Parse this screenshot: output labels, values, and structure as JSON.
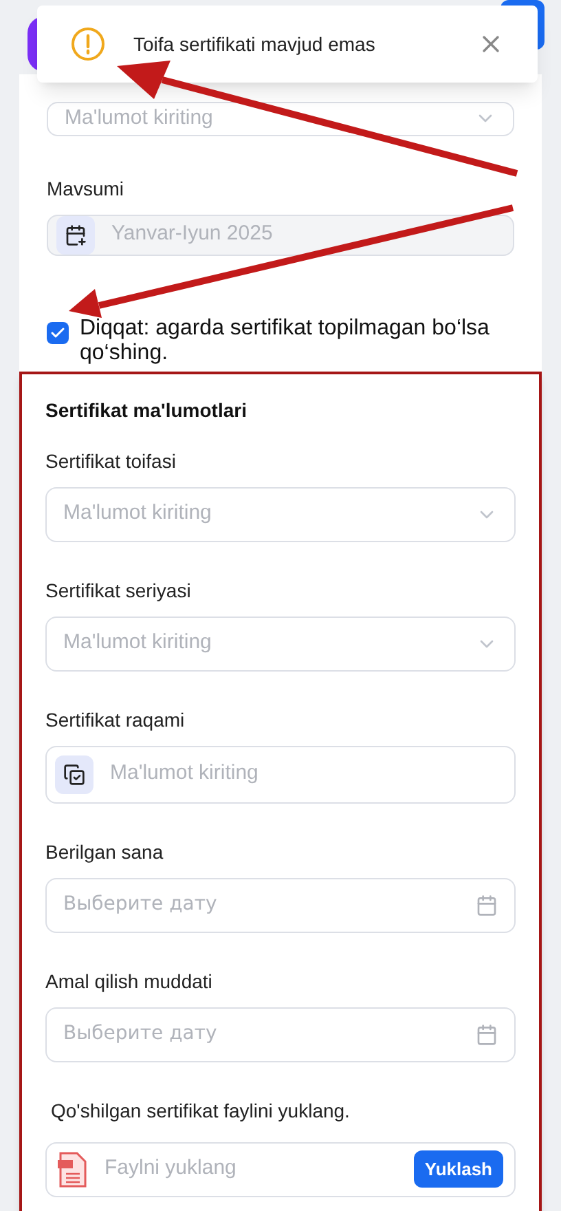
{
  "toast": {
    "message": "Toifa sertifikati mavjud emas"
  },
  "top_field": {
    "kind": "select",
    "placeholder": "Ma'lumot kiriting"
  },
  "season": {
    "label": "Mavsumi",
    "kind": "disabled",
    "value": "Yanvar-Iyun 2025"
  },
  "notice_checkbox": {
    "label": "Diqqat: agarda sertifikat topilmagan bo‘lsa qo‘shing.",
    "checked": true
  },
  "certificate_section": {
    "title": "Sertifikat ma'lumotlari",
    "fields": [
      {
        "label": "Sertifikat toifasi",
        "kind": "select",
        "placeholder": "Ma'lumot kiriting"
      },
      {
        "label": "Sertifikat seriyasi",
        "kind": "select",
        "placeholder": "Ma'lumot kiriting"
      },
      {
        "label": "Sertifikat raqami",
        "kind": "text",
        "placeholder": "Ma'lumot kiriting"
      },
      {
        "label": "Berilgan sana",
        "kind": "date",
        "placeholder": "Выберите дату"
      },
      {
        "label": "Amal qilish muddati",
        "kind": "date",
        "placeholder": "Выберите дату"
      }
    ],
    "upload": {
      "label": "Qo'shilgan sertifikat faylini yuklang.",
      "placeholder": "Faylni yuklang",
      "button": "Yuklash"
    }
  }
}
